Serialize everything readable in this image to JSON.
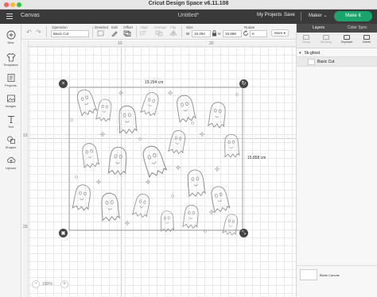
{
  "window": {
    "title": "Cricut Design Space  v6.11.108"
  },
  "header": {
    "section": "Canvas",
    "doc_title": "Untitled*",
    "my_projects": "My Projects",
    "save": "Save",
    "machine": "Maker",
    "make_it": "Make It"
  },
  "toolbar": {
    "operation_label": "Operation",
    "operation_value": "Basic Cut",
    "deselect": "Deselect",
    "edit": "Edit",
    "offset": "Offset",
    "align": "Align",
    "arrange": "Arrange",
    "flip": "Flip",
    "size_label": "Size",
    "w_label": "W",
    "w_value": "19.294",
    "h_label": "H",
    "h_value": "15.858",
    "rotate_label": "Rotate",
    "rotate_value": "0",
    "more": "More"
  },
  "sidebar": {
    "items": [
      {
        "label": "New",
        "icon": "plus-icon"
      },
      {
        "label": "Templates",
        "icon": "shirt-icon"
      },
      {
        "label": "Projects",
        "icon": "projects-icon"
      },
      {
        "label": "Images",
        "icon": "image-icon"
      },
      {
        "label": "Text",
        "icon": "text-icon"
      },
      {
        "label": "Shapes",
        "icon": "shapes-icon"
      },
      {
        "label": "Upload",
        "icon": "upload-icon"
      }
    ]
  },
  "canvas": {
    "ruler_top": [
      "10",
      "20"
    ],
    "ruler_left": [
      "10",
      "20"
    ],
    "width_label": "19.294 cm",
    "height_label": "15.858 cm",
    "zoom_value": "100%"
  },
  "panel": {
    "tabs": [
      "Layers",
      "Color Sync"
    ],
    "actions": [
      "Group",
      "UnGroup",
      "Duplicate",
      "Delete"
    ],
    "layer_group": "5k-ghost",
    "layer_item": "Basic Cut",
    "blank_canvas": "Blank Canvas"
  }
}
